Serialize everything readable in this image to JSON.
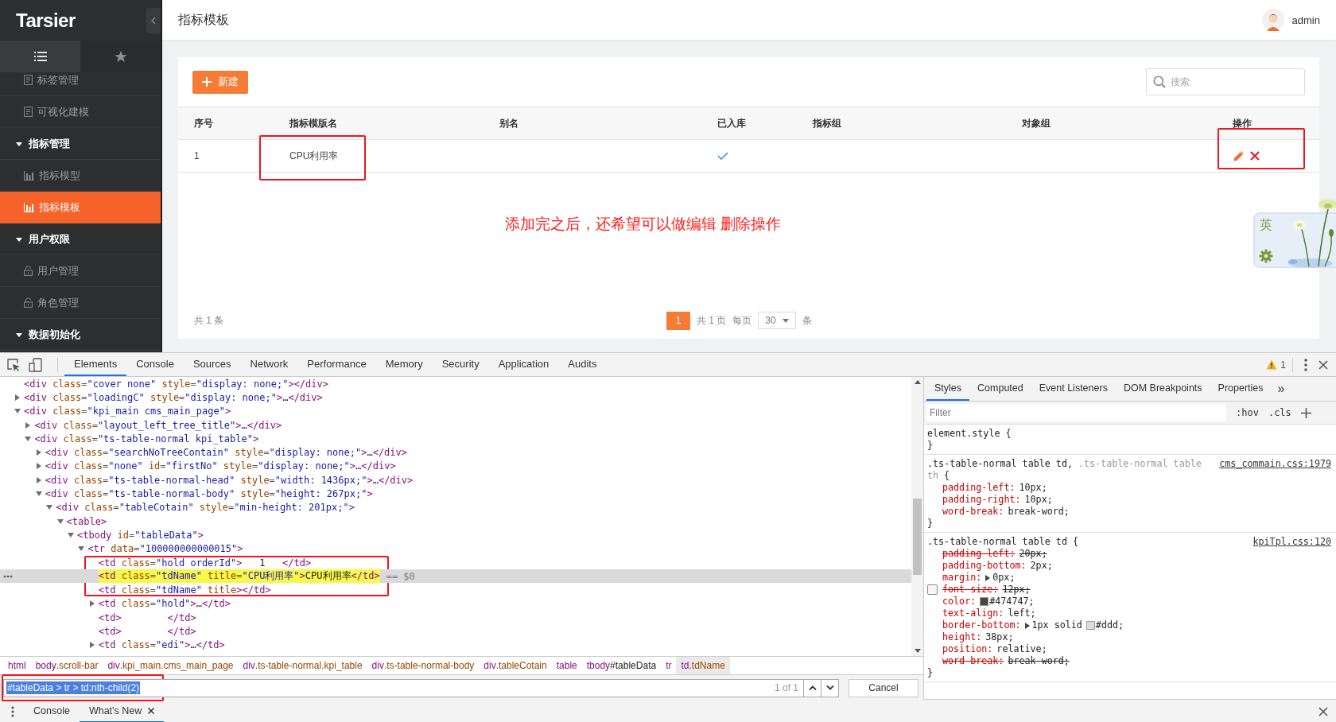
{
  "app": {
    "logo": "Tarsier",
    "sidebar_tabs": [
      {
        "kind": "menu",
        "selected": true
      },
      {
        "kind": "star",
        "selected": false
      }
    ],
    "menu": [
      {
        "kind": "doc",
        "label": "标签管理",
        "selected": false
      },
      {
        "kind": "doc",
        "label": "可视化建模",
        "selected": false
      },
      {
        "kind": "group",
        "label": "指标管理",
        "expanded": true,
        "children": [
          {
            "kind": "chart",
            "label": "指标模型",
            "selected": false
          },
          {
            "kind": "chart",
            "label": "指标模板",
            "selected": true
          }
        ]
      },
      {
        "kind": "group",
        "label": "用户权限",
        "expanded": true,
        "children": [
          {
            "kind": "lock",
            "label": "用户管理",
            "selected": false
          },
          {
            "kind": "lock",
            "label": "角色管理",
            "selected": false
          }
        ]
      },
      {
        "kind": "group",
        "label": "数据初始化",
        "expanded": true
      }
    ],
    "page_title": "指标模板",
    "user": "admin",
    "new_button": "新建",
    "search": {
      "placeholder": "搜索"
    },
    "table": {
      "columns": [
        "序号",
        "指标模版名",
        "别名",
        "已入库",
        "指标组",
        "对象组",
        "操作"
      ],
      "rows": [
        {
          "index": "1",
          "name": "CPU利用率",
          "in_library": true,
          "name_marked": true,
          "actions_marked": true
        }
      ]
    },
    "note": "添加完之后，还希望可以做编辑 删除操作",
    "total": "共 1 条",
    "pagination": {
      "pages": [
        {
          "label": "1",
          "selected": true
        }
      ],
      "summary": "共 1 页",
      "per_page_label": "每页",
      "per_page": "30",
      "unit": "条"
    },
    "ime": {
      "label": "英"
    }
  },
  "devtools": {
    "tabs": [
      {
        "label": "Elements",
        "selected": true
      },
      {
        "label": "Console",
        "selected": false
      },
      {
        "label": "Sources",
        "selected": false
      },
      {
        "label": "Network",
        "selected": false
      },
      {
        "label": "Performance",
        "selected": false
      },
      {
        "label": "Memory",
        "selected": false
      },
      {
        "label": "Security",
        "selected": false
      },
      {
        "label": "Application",
        "selected": false
      },
      {
        "label": "Audits",
        "selected": false
      }
    ],
    "warnings": "1",
    "dom": [
      {
        "kind": "leaf",
        "markup": "<div class=\"cover none\" style=\"display: none;\"></div>",
        "selected": false,
        "match": false,
        "marked": false
      },
      {
        "kind": "branch",
        "expanded": false,
        "markup": "<div class=\"loadingC\" style=\"display: none;\">…</div>",
        "selected": false,
        "match": false,
        "marked": false
      },
      {
        "kind": "branch",
        "expanded": true,
        "markup": "<div class=\"kpi_main cms_main_page\">",
        "selected": false,
        "match": false,
        "marked": false,
        "children": [
          {
            "kind": "branch",
            "expanded": false,
            "markup": "<div class=\"layout_left_tree_title\">…</div>",
            "selected": false,
            "match": false,
            "marked": false
          },
          {
            "kind": "branch",
            "expanded": true,
            "markup": "<div class=\"ts-table-normal kpi_table\">",
            "selected": false,
            "match": false,
            "marked": false,
            "children": [
              {
                "kind": "branch",
                "expanded": false,
                "markup": "<div class=\"searchNoTreeContain\" style=\"display: none;\">…</div>",
                "selected": false,
                "match": false,
                "marked": false
              },
              {
                "kind": "branch",
                "expanded": false,
                "markup": "<div class=\"none\" id=\"firstNo\" style=\"display: none;\">…</div>",
                "selected": false,
                "match": false,
                "marked": false
              },
              {
                "kind": "branch",
                "expanded": false,
                "markup": "<div class=\"ts-table-normal-head\" style=\"width: 1436px;\">…</div>",
                "selected": false,
                "match": false,
                "marked": false
              },
              {
                "kind": "branch",
                "expanded": true,
                "markup": "<div class=\"ts-table-normal-body\" style=\"height: 267px;\">",
                "selected": false,
                "match": false,
                "marked": false,
                "children": [
                  {
                    "kind": "branch",
                    "expanded": true,
                    "markup": "<div class=\"tableCotain\" style=\"min-height: 201px;\">",
                    "selected": false,
                    "match": false,
                    "marked": false,
                    "children": [
                      {
                        "kind": "branch",
                        "expanded": true,
                        "markup": "<table>",
                        "selected": false,
                        "match": false,
                        "marked": false,
                        "children": [
                          {
                            "kind": "branch",
                            "expanded": true,
                            "markup": "<tbody id=\"tableData\">",
                            "selected": false,
                            "match": false,
                            "marked": false,
                            "children": [
                              {
                                "kind": "branch",
                                "expanded": true,
                                "markup": "<tr data=\"100000000000015\">",
                                "selected": false,
                                "match": false,
                                "marked": false,
                                "children": [
                                  {
                                    "kind": "leaf",
                                    "markup": "<td class=\"hold orderId\">   1   </td>",
                                    "selected": false,
                                    "match": false,
                                    "marked": true
                                  },
                                  {
                                    "kind": "leaf",
                                    "markup": "<td class=\"tdName\" title=\"CPU利用率\">CPU利用率</td>",
                                    "suffix": "== $0",
                                    "selected": true,
                                    "match": true,
                                    "marked": true
                                  },
                                  {
                                    "kind": "leaf",
                                    "markup": "<td class=\"tdName\" title></td>",
                                    "selected": false,
                                    "match": false,
                                    "marked": true
                                  },
                                  {
                                    "kind": "branch",
                                    "expanded": false,
                                    "markup": "<td class=\"hold\">…</td>",
                                    "selected": false,
                                    "match": false,
                                    "marked": false
                                  },
                                  {
                                    "kind": "leaf",
                                    "markup": "<td>        </td>",
                                    "selected": false,
                                    "match": false,
                                    "marked": false
                                  },
                                  {
                                    "kind": "leaf",
                                    "markup": "<td>        </td>",
                                    "selected": false,
                                    "match": false,
                                    "marked": false
                                  },
                                  {
                                    "kind": "branch",
                                    "expanded": false,
                                    "markup": "<td class=\"edi\">…</td>",
                                    "selected": false,
                                    "match": false,
                                    "marked": false
                                  }
                                ]
                              }
                            ]
                          }
                        ]
                      }
                    ]
                  }
                ]
              }
            ]
          }
        ]
      }
    ],
    "breadcrumbs": [
      {
        "label": "html",
        "selected": false
      },
      {
        "label": "body.scroll-bar",
        "selected": false
      },
      {
        "label": "div.kpi_main.cms_main_page",
        "selected": false
      },
      {
        "label": "div.ts-table-normal.kpi_table",
        "selected": false
      },
      {
        "label": "div.ts-table-normal-body",
        "selected": false
      },
      {
        "label": "div.tableCotain",
        "selected": false
      },
      {
        "label": "table",
        "selected": false
      },
      {
        "label": "tbody#tableData",
        "selected": false
      },
      {
        "label": "tr",
        "selected": false
      },
      {
        "label": "td.tdName",
        "selected": true
      }
    ],
    "search": {
      "value": "#tableData > tr > td:nth-child(2)",
      "marked": true,
      "matches": "1 of 1",
      "cancel": "Cancel"
    },
    "drawer_tabs": [
      {
        "label": "Console",
        "selected": false,
        "closable": false
      },
      {
        "label": "What's New",
        "selected": true,
        "closable": true
      }
    ],
    "styles": {
      "tabs": [
        {
          "label": "Styles",
          "selected": true
        },
        {
          "label": "Computed",
          "selected": false
        },
        {
          "label": "Event Listeners",
          "selected": false
        },
        {
          "label": "DOM Breakpoints",
          "selected": false
        },
        {
          "label": "Properties",
          "selected": false
        }
      ],
      "more_tabs": "»",
      "filter": {
        "placeholder": "Filter"
      },
      "toggles": [
        ":hov",
        ".cls"
      ],
      "rules": [
        {
          "selector": [
            {
              "text": "element.style {",
              "matched": true
            }
          ],
          "close": "}"
        },
        {
          "selector": [
            {
              "text": ".ts-table-normal table td, ",
              "matched": true
            },
            {
              "text": ".ts-table-normal table th",
              "matched": false
            },
            {
              "text": " {",
              "matched": true
            }
          ],
          "source": "cms_commain.css:1979",
          "close": "}",
          "properties": [
            {
              "text": "padding-left: 10px;",
              "overridden": false,
              "expandable": false,
              "hovered": false
            },
            {
              "text": "padding-right: 10px;",
              "overridden": false,
              "expandable": false,
              "hovered": false
            },
            {
              "text": "word-break: break-word;",
              "overridden": false,
              "expandable": false,
              "hovered": false
            }
          ]
        },
        {
          "selector": [
            {
              "text": ".ts-table-normal table td {",
              "matched": true
            }
          ],
          "source": "kpiTpl.css:120",
          "close": "}",
          "properties": [
            {
              "text": "padding-left: 20px;",
              "overridden": true,
              "expandable": false,
              "hovered": false
            },
            {
              "text": "padding-bottom: 2px;",
              "overridden": false,
              "expandable": false,
              "hovered": false
            },
            {
              "text": "margin: 0px;",
              "overridden": false,
              "expandable": true,
              "hovered": false
            },
            {
              "text": "font-size: 12px;",
              "overridden": true,
              "expandable": false,
              "hovered": true
            },
            {
              "text": "color: #474747;",
              "overridden": false,
              "expandable": false,
              "hovered": false
            },
            {
              "text": "text-align: left;",
              "overridden": false,
              "expandable": false,
              "hovered": false
            },
            {
              "text": "border-bottom: 1px solid #ddd;",
              "overridden": false,
              "expandable": true,
              "hovered": false
            },
            {
              "text": "height: 38px;",
              "overridden": false,
              "expandable": false,
              "hovered": false
            },
            {
              "text": "position: relative;",
              "overridden": false,
              "expandable": false,
              "hovered": false
            },
            {
              "text": "word-break: break-word;",
              "overridden": true,
              "expandable": false,
              "hovered": false
            }
          ]
        }
      ]
    }
  }
}
